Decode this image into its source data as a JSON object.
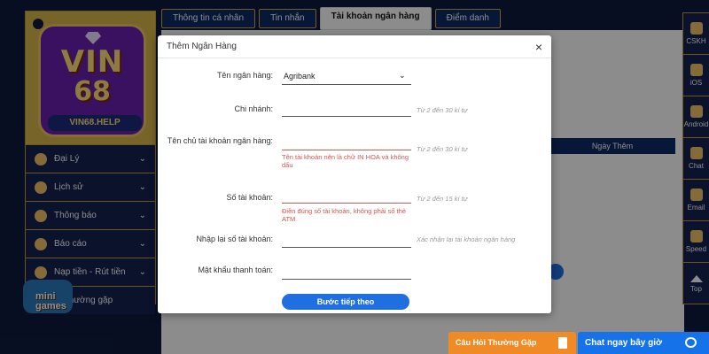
{
  "tabs": [
    {
      "label": "Thông tin cá nhân"
    },
    {
      "label": "Tin nhắn"
    },
    {
      "label": "Tài khoản ngân hàng"
    },
    {
      "label": "Điểm danh"
    }
  ],
  "background": {
    "table_header": "Ngày Thêm"
  },
  "sidebar": {
    "logo": {
      "line1": "VIN",
      "line2": "68",
      "badge": "VIN68.HELP"
    },
    "items": [
      {
        "label": "Đại Lý",
        "icon": "agents-icon"
      },
      {
        "label": "Lịch sử",
        "icon": "history-icon"
      },
      {
        "label": "Thông báo",
        "icon": "bell-icon"
      },
      {
        "label": "Báo cáo",
        "icon": "report-icon"
      },
      {
        "label": "Nạp tiền - Rút tiền",
        "icon": "money-icon"
      },
      {
        "label": "thường gặp",
        "icon": "question-icon"
      }
    ],
    "mini_games": {
      "line1": "mini",
      "line2": "games"
    }
  },
  "rail": [
    {
      "label": "CSKH",
      "icon": "support-icon"
    },
    {
      "label": "iOS",
      "icon": "apple-icon"
    },
    {
      "label": "Android",
      "icon": "android-icon"
    },
    {
      "label": "Chat",
      "icon": "zalo-icon"
    },
    {
      "label": "Email",
      "icon": "email-icon"
    },
    {
      "label": "Speed",
      "icon": "speed-icon"
    },
    {
      "label": "Top",
      "icon": "arrow-up-icon"
    }
  ],
  "widgets": {
    "faq": "Câu Hỏi Thường Gặp",
    "chat": "Chat ngay bây giờ"
  },
  "modal": {
    "title": "Thêm Ngân Hàng",
    "close": "×",
    "fields": {
      "bank_name": {
        "label": "Tên ngân hàng:",
        "value": "Agribank"
      },
      "branch": {
        "label": "Chi nhánh:",
        "hint": "Từ 2 đến 30 kí tự"
      },
      "holder": {
        "label": "Tên chủ tài khoản ngân hàng:",
        "hint": "Từ 2 đến 30 kí tự",
        "error": "Tên tài khoản nên là chữ IN HOA và không dấu"
      },
      "account_number": {
        "label": "Số tài khoản:",
        "hint": "Từ 2 đến 15 kí tự",
        "error": "Điền đúng số tài khoản, không phải số thẻ ATM"
      },
      "account_confirm": {
        "label": "Nhập lại số tài khoản:",
        "hint": "Xác nhận lại tài khoản ngân hàng"
      },
      "password": {
        "label": "Mật khẩu thanh toán:"
      }
    },
    "submit": "Bước tiếp theo"
  }
}
